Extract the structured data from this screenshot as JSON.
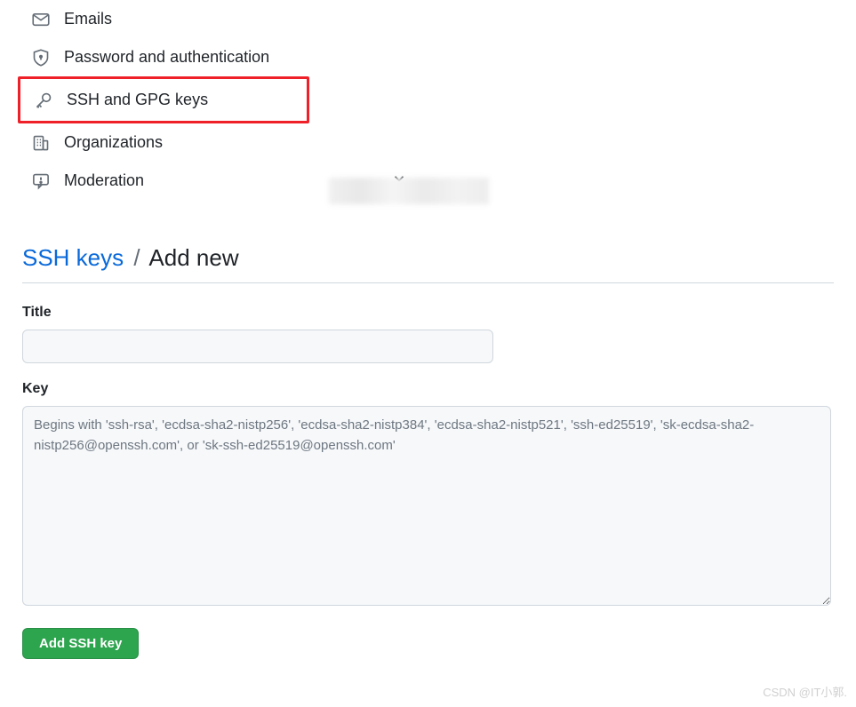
{
  "sidebar": {
    "items": [
      {
        "label": "Emails",
        "icon": "mail-icon"
      },
      {
        "label": "Password and authentication",
        "icon": "shield-lock-icon"
      },
      {
        "label": "SSH and GPG keys",
        "icon": "key-icon"
      },
      {
        "label": "Organizations",
        "icon": "organization-icon"
      },
      {
        "label": "Moderation",
        "icon": "report-icon"
      }
    ]
  },
  "breadcrumb": {
    "link_label": "SSH keys",
    "separator": "/",
    "current_label": "Add new"
  },
  "form": {
    "title_label": "Title",
    "title_value": "",
    "key_label": "Key",
    "key_value": "",
    "key_placeholder": "Begins with 'ssh-rsa', 'ecdsa-sha2-nistp256', 'ecdsa-sha2-nistp384', 'ecdsa-sha2-nistp521', 'ssh-ed25519', 'sk-ecdsa-sha2-nistp256@openssh.com', or 'sk-ssh-ed25519@openssh.com'",
    "submit_label": "Add SSH key"
  },
  "watermark": "CSDN @IT小郭."
}
